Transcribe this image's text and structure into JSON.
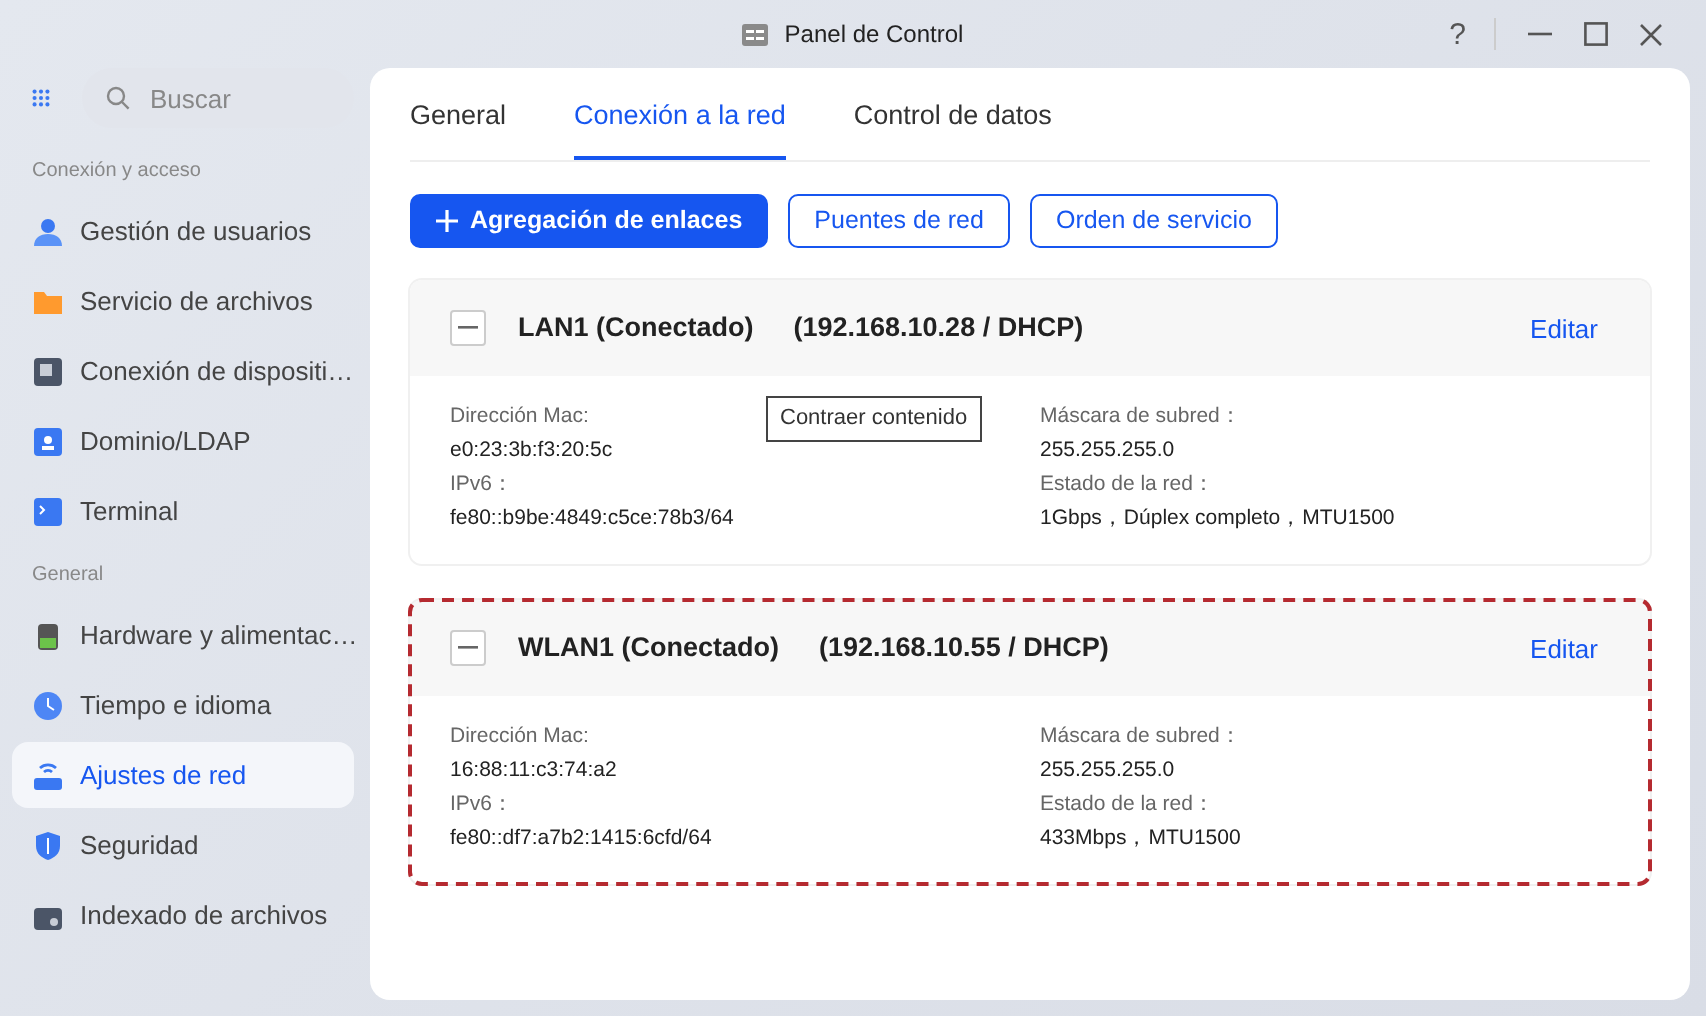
{
  "window": {
    "title": "Panel de Control",
    "help": "?"
  },
  "sidebar": {
    "search": {
      "placeholder": "Buscar"
    },
    "sections": [
      {
        "heading": "Conexión y acceso",
        "items": [
          {
            "label": "Gestión de usuarios",
            "selected": false
          },
          {
            "label": "Servicio de archivos",
            "selected": false
          },
          {
            "label": "Conexión de dispositi…",
            "selected": false
          },
          {
            "label": "Dominio/LDAP",
            "selected": false
          },
          {
            "label": "Terminal",
            "selected": false
          }
        ]
      },
      {
        "heading": "General",
        "items": [
          {
            "label": "Hardware y alimentac…",
            "selected": false
          },
          {
            "label": "Tiempo e idioma",
            "selected": false
          },
          {
            "label": "Ajustes de red",
            "selected": true
          },
          {
            "label": "Seguridad",
            "selected": false
          },
          {
            "label": "Indexado de archivos",
            "selected": false
          }
        ]
      }
    ]
  },
  "tabs": [
    {
      "label": "General",
      "selected": false
    },
    {
      "label": "Conexión a la red",
      "selected": true
    },
    {
      "label": "Control de datos",
      "selected": false
    }
  ],
  "actions": [
    {
      "label": "Agregación de enlaces",
      "kind": "primary"
    },
    {
      "label": "Puentes de red",
      "kind": "outline"
    },
    {
      "label": "Orden de servicio",
      "kind": "outline"
    }
  ],
  "interfaces": [
    {
      "name": "LAN1 (Conectado)",
      "address": "(192.168.10.28 / DHCP)",
      "edit": "Editar",
      "expanded": true,
      "highlighted": false,
      "tooltip": "Contraer contenido",
      "left": [
        {
          "label": "Dirección Mac:",
          "value": "e0:23:3b:f3:20:5c"
        },
        {
          "label": "IPv6：",
          "value": "fe80::b9be:4849:c5ce:78b3/64"
        }
      ],
      "right": [
        {
          "label": "Máscara de subred：",
          "value": "255.255.255.0"
        },
        {
          "label": "Estado de la red：",
          "value": "1Gbps，Dúplex completo，MTU1500"
        }
      ]
    },
    {
      "name": "WLAN1 (Conectado)",
      "address": "(192.168.10.55 / DHCP)",
      "edit": "Editar",
      "expanded": true,
      "highlighted": true,
      "left": [
        {
          "label": "Dirección Mac:",
          "value": "16:88:11:c3:74:a2"
        },
        {
          "label": "IPv6：",
          "value": "fe80::df7:a7b2:1415:6cfd/64"
        }
      ],
      "right": [
        {
          "label": "Máscara de subred：",
          "value": "255.255.255.0"
        },
        {
          "label": "Estado de la red：",
          "value": "433Mbps，MTU1500"
        }
      ]
    }
  ]
}
